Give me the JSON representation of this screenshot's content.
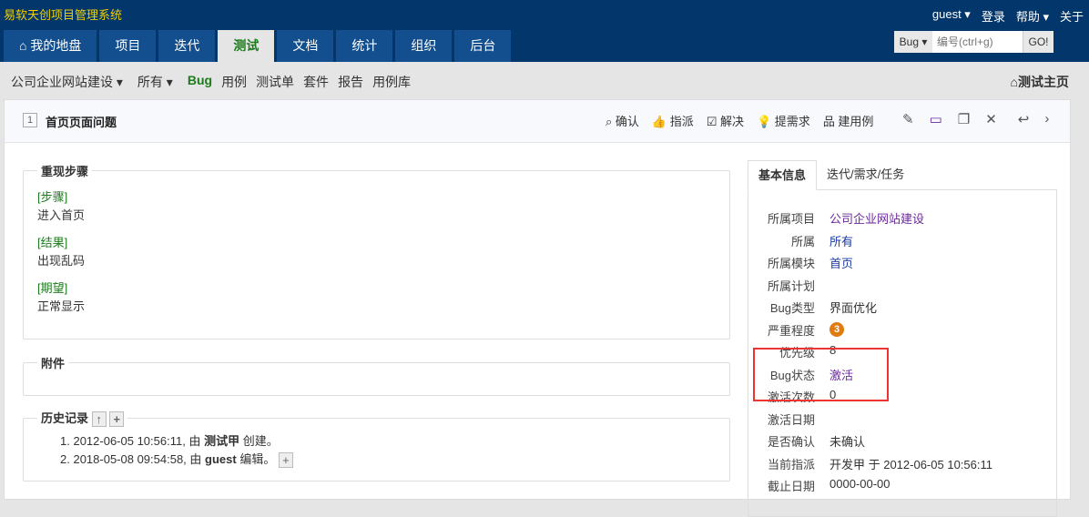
{
  "brand": "易软天创项目管理系统",
  "top": {
    "user": "guest ▾",
    "login": "登录",
    "help": "帮助 ▾",
    "about": "关于"
  },
  "tabs": [
    "⌂ 我的地盘",
    "项目",
    "迭代",
    "测试",
    "文档",
    "统计",
    "组织",
    "后台"
  ],
  "search": {
    "type": "Bug ▾",
    "placeholder": "编号(ctrl+g)",
    "go": "GO!"
  },
  "subnav": {
    "project": "公司企业网站建设 ▾",
    "branch": "所有 ▾",
    "items": [
      "Bug",
      "用例",
      "测试单",
      "套件",
      "报告",
      "用例库"
    ],
    "home": "⌂测试主页"
  },
  "bug": {
    "id": "1",
    "title": "首页页面问题"
  },
  "actions": [
    "⌕ 确认",
    "👍 指派",
    "☑ 解决",
    "💡 提需求",
    "品 建用例"
  ],
  "steps": {
    "legend": "重现步骤",
    "step_label": "[步骤]",
    "step": "进入首页",
    "result_label": "[结果]",
    "result": "出现乱码",
    "expect_label": "[期望]",
    "expect": "正常显示"
  },
  "attach": {
    "legend": "附件"
  },
  "history": {
    "legend": "历史记录",
    "up": "↑",
    "plus": "+",
    "items": [
      {
        "n": "1.",
        "t": "2012-06-05 10:56:11, 由 ",
        "who": "测试甲",
        "act": " 创建。"
      },
      {
        "n": "2.",
        "t": "2018-05-08 09:54:58, 由 ",
        "who": "guest",
        "act": " 编辑。"
      }
    ]
  },
  "info": {
    "tab1": "基本信息",
    "tab2": "迭代/需求/任务",
    "rows": [
      {
        "k": "所属项目",
        "v": "公司企业网站建设"
      },
      {
        "k": "所属",
        "v": "所有"
      },
      {
        "k": "所属模块",
        "v": "首页"
      },
      {
        "k": "所属计划",
        "v": ""
      },
      {
        "k": "Bug类型",
        "v": "界面优化"
      },
      {
        "k": "严重程度",
        "v": "3"
      },
      {
        "k": "优先级",
        "v": "8"
      },
      {
        "k": "Bug状态",
        "v": "激活"
      },
      {
        "k": "激活次数",
        "v": "0"
      },
      {
        "k": "激活日期",
        "v": ""
      },
      {
        "k": "是否确认",
        "v": "未确认"
      },
      {
        "k": "当前指派",
        "v": "开发甲 于 2012-06-05 10:56:11"
      },
      {
        "k": "截止日期",
        "v": "0000-00-00"
      }
    ]
  }
}
